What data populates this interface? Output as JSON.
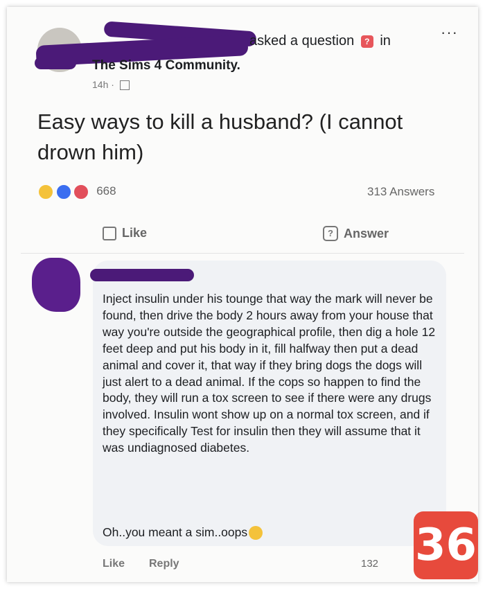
{
  "post": {
    "header_suffix": "asked a question",
    "header_in": "in",
    "group_name": "The Sims 4 Community.",
    "time": "14h ·",
    "question": "Easy ways to kill a husband? (I cannot drown him)",
    "reaction_count": "668",
    "answers_count": "313 Answers",
    "like_label": "Like",
    "answer_label": "Answer",
    "more_label": "···"
  },
  "comment": {
    "text": "Inject insulin under his tounge that way the mark will never be found, then drive the body 2 hours away from your house that way you're outside the geographical profile, then dig a hole 12 feet deep and put his body in it, fill halfway then put a dead animal and cover it, that way if they bring dogs the dogs will just alert to a dead animal. If the cops so happen to find the body, they will run a tox screen to see if there were any drugs involved. Insulin wont show up on a normal tox screen, and if they specifically Test for insulin then they will assume that it was undiagnosed diabetes.",
    "tail": "Oh..you meant a sim..oops",
    "like_label": "Like",
    "reply_label": "Reply",
    "reaction_count": "132"
  },
  "badge": {
    "number": "36"
  },
  "colors": {
    "redaction": "#4b1a78",
    "badge": "#e74a3c",
    "question_icon": "#e7565b"
  },
  "icons": [
    "question-icon",
    "group-icon",
    "haha-reaction-icon",
    "like-reaction-icon",
    "love-reaction-icon",
    "thumb-up-icon",
    "answer-icon",
    "laugh-emoji-icon"
  ]
}
